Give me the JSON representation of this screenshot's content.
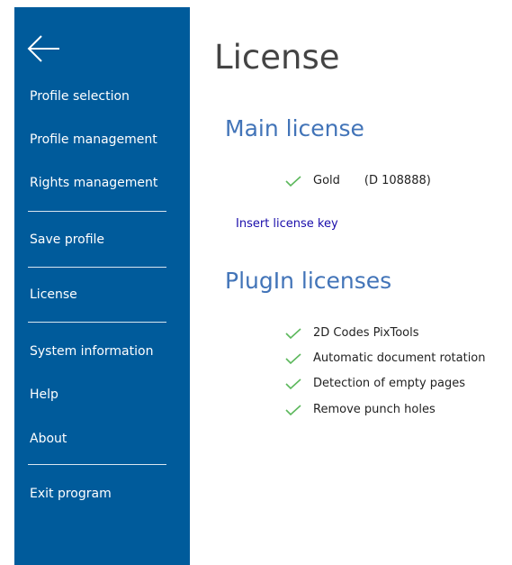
{
  "sidebar": {
    "items": [
      {
        "label": "Profile selection"
      },
      {
        "label": "Profile management"
      },
      {
        "label": "Rights management"
      },
      {
        "label": "Save profile"
      },
      {
        "label": "License"
      },
      {
        "label": "System information"
      },
      {
        "label": "Help"
      },
      {
        "label": "About"
      },
      {
        "label": "Exit program"
      }
    ]
  },
  "main": {
    "title": "License",
    "main_license": {
      "heading": "Main license",
      "level": "Gold",
      "id": "(D 108888)",
      "insert_key_link": "Insert license key"
    },
    "plugin_licenses": {
      "heading": "PlugIn licenses",
      "items": [
        "2D Codes PixTools",
        "Automatic document rotation",
        "Detection of empty pages",
        "Remove punch holes"
      ]
    }
  },
  "icons": {
    "back": "back-arrow-icon",
    "check": "checkmark-icon"
  },
  "colors": {
    "sidebar": "#005b9b",
    "heading": "#4274b8",
    "check": "#5cb85c",
    "link": "#1a0dab"
  }
}
